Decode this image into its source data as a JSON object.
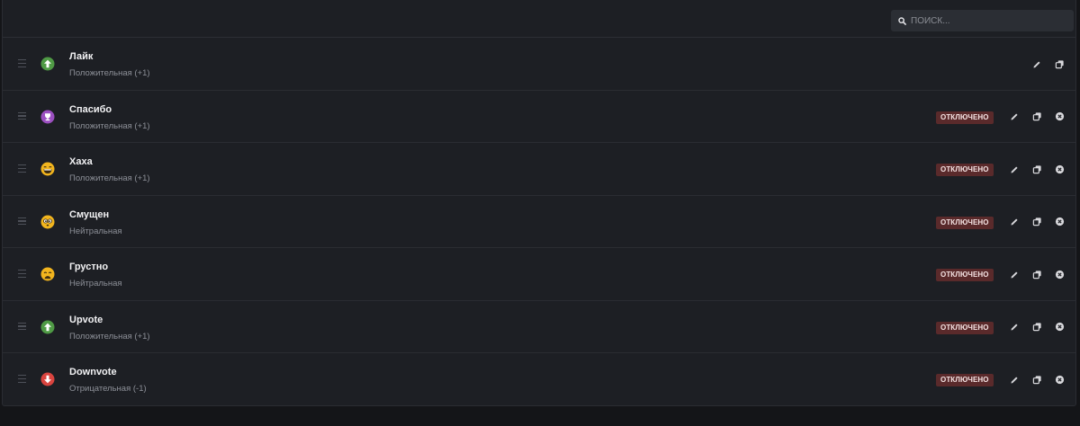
{
  "search": {
    "placeholder": "ПОИСК..."
  },
  "reactions": [
    {
      "title": "Лайк",
      "subtitle": "Положительная (+1)",
      "icon": "arrow-up-green-icon",
      "disabled": false
    },
    {
      "title": "Спасибо",
      "subtitle": "Положительная (+1)",
      "icon": "trophy-purple-icon",
      "disabled": true
    },
    {
      "title": "Хаха",
      "subtitle": "Положительная (+1)",
      "icon": "laughing-face-icon",
      "disabled": true
    },
    {
      "title": "Смущен",
      "subtitle": "Нейтральная",
      "icon": "confused-face-icon",
      "disabled": true
    },
    {
      "title": "Грустно",
      "subtitle": "Нейтральная",
      "icon": "sad-face-icon",
      "disabled": true
    },
    {
      "title": "Upvote",
      "subtitle": "Положительная (+1)",
      "icon": "arrow-up-green-icon",
      "disabled": true
    },
    {
      "title": "Downvote",
      "subtitle": "Отрицательная (-1)",
      "icon": "arrow-down-red-icon",
      "disabled": true
    }
  ],
  "badge_label": "ОТКЛЮЧЕНО",
  "colors": {
    "positive": "#4f9a45",
    "negative": "#d9443f",
    "trophy": "#9b4fc0",
    "emoji_yellow": "#f2b51e",
    "badge_bg": "#5a2a2b"
  }
}
